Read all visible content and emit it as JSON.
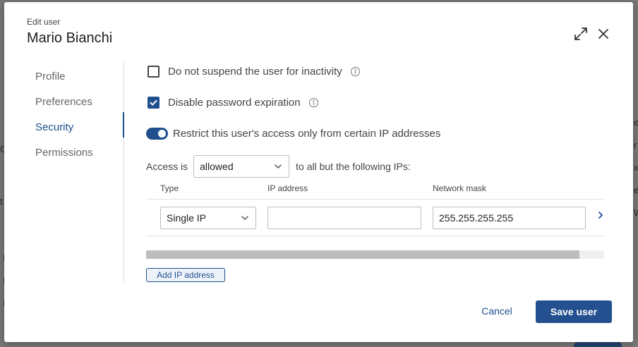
{
  "background": {
    "fragments": [
      "G",
      "t",
      "I",
      "I",
      "I",
      "e",
      "r",
      "x",
      "e",
      "W"
    ]
  },
  "modal": {
    "subtitle": "Edit user",
    "title": "Mario Bianchi"
  },
  "sidebar": {
    "items": [
      {
        "label": "Profile"
      },
      {
        "label": "Preferences"
      },
      {
        "label": "Security",
        "active": true
      },
      {
        "label": "Permissions"
      }
    ]
  },
  "security": {
    "no_suspend": {
      "label": "Do not suspend the user for inactivity",
      "checked": false
    },
    "disable_pwd_exp": {
      "label": "Disable password expiration",
      "checked": true
    },
    "restrict_ip": {
      "label": "Restrict this user's access only from certain IP addresses",
      "on": true
    },
    "access_prefix": "Access is",
    "access_value": "allowed",
    "access_suffix": "to all but the following IPs:",
    "table": {
      "headers": [
        "Type",
        "IP address",
        "Network mask"
      ],
      "rows": [
        {
          "type": "Single IP",
          "ip": "",
          "mask": "255.255.255.255"
        }
      ]
    },
    "add_ip_label": "Add IP address"
  },
  "footer": {
    "cancel_label": "Cancel",
    "save_label": "Save user"
  },
  "colors": {
    "accent": "#1f4f8d",
    "primary_button": "#24508f"
  }
}
